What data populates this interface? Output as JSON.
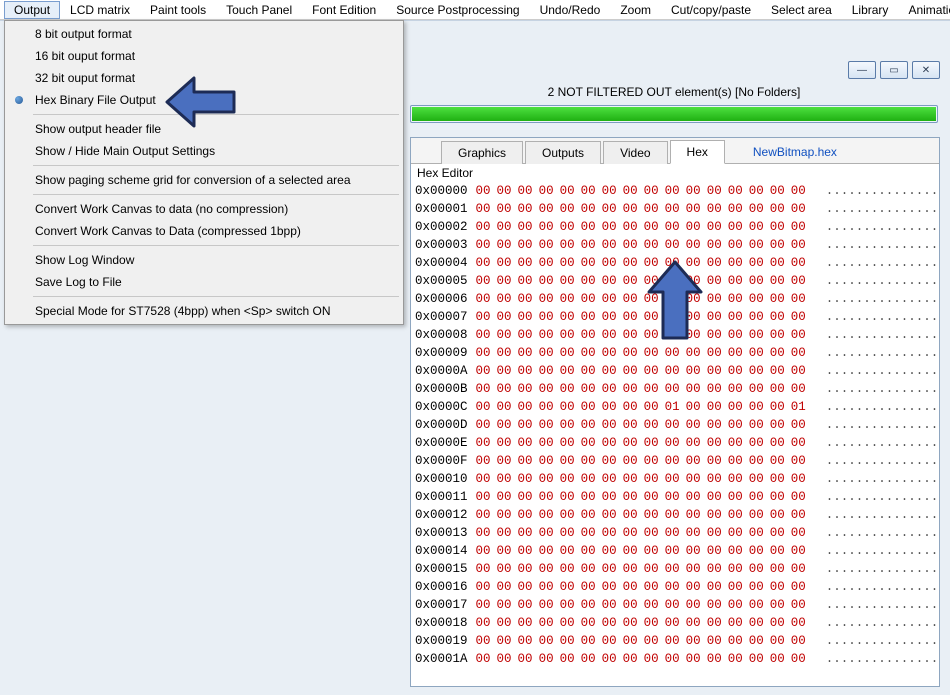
{
  "menubar": {
    "items": [
      "Output",
      "LCD matrix",
      "Paint tools",
      "Touch Panel",
      "Font Edition",
      "Source Postprocessing",
      "Undo/Redo",
      "Zoom",
      "Cut/copy/paste",
      "Select area",
      "Library",
      "Animation"
    ],
    "active_index": 0
  },
  "dropdown": {
    "groups": [
      [
        {
          "label": "8 bit output format",
          "checked": false
        },
        {
          "label": "16 bit ouput format",
          "checked": false
        },
        {
          "label": "32 bit ouput format",
          "checked": false
        },
        {
          "label": "Hex Binary File Output",
          "checked": true
        }
      ],
      [
        {
          "label": "Show output header file",
          "checked": false
        },
        {
          "label": "Show / Hide Main Output  Settings",
          "checked": false
        }
      ],
      [
        {
          "label": "Show paging scheme grid for conversion of a selected area",
          "checked": false
        }
      ],
      [
        {
          "label": "Convert Work Canvas to data (no compression)",
          "checked": false
        },
        {
          "label": "Convert Work Canvas to Data (compressed 1bpp)",
          "checked": false
        }
      ],
      [
        {
          "label": "Show Log Window",
          "checked": false
        },
        {
          "label": "Save Log to File",
          "checked": false
        }
      ],
      [
        {
          "label": "Special Mode for ST7528 (4bpp) when <Sp> switch ON",
          "checked": false
        }
      ]
    ]
  },
  "window": {
    "status_text": "2 NOT FILTERED OUT element(s) [No Folders]",
    "progress_pct": 100,
    "controls": {
      "min": "—",
      "max": "▭",
      "close": "✕"
    }
  },
  "tabs": {
    "items": [
      "Graphics",
      "Outputs",
      "Video",
      "Hex"
    ],
    "active_index": 3,
    "link": "NewBitmap.hex"
  },
  "hex": {
    "title": "Hex Editor",
    "ascii_placeholder": "................",
    "rows": [
      {
        "addr": "0x00000",
        "bytes": [
          "00",
          "00",
          "00",
          "00",
          "00",
          "00",
          "00",
          "00",
          "00",
          "00",
          "00",
          "00",
          "00",
          "00",
          "00",
          "00"
        ]
      },
      {
        "addr": "0x00001",
        "bytes": [
          "00",
          "00",
          "00",
          "00",
          "00",
          "00",
          "00",
          "00",
          "00",
          "00",
          "00",
          "00",
          "00",
          "00",
          "00",
          "00"
        ]
      },
      {
        "addr": "0x00002",
        "bytes": [
          "00",
          "00",
          "00",
          "00",
          "00",
          "00",
          "00",
          "00",
          "00",
          "00",
          "00",
          "00",
          "00",
          "00",
          "00",
          "00"
        ]
      },
      {
        "addr": "0x00003",
        "bytes": [
          "00",
          "00",
          "00",
          "00",
          "00",
          "00",
          "00",
          "00",
          "00",
          "00",
          "00",
          "00",
          "00",
          "00",
          "00",
          "00"
        ]
      },
      {
        "addr": "0x00004",
        "bytes": [
          "00",
          "00",
          "00",
          "00",
          "00",
          "00",
          "00",
          "00",
          "00",
          "00",
          "00",
          "00",
          "00",
          "00",
          "00",
          "00"
        ]
      },
      {
        "addr": "0x00005",
        "bytes": [
          "00",
          "00",
          "00",
          "00",
          "00",
          "00",
          "00",
          "00",
          "00",
          "00",
          "00",
          "00",
          "00",
          "00",
          "00",
          "00"
        ]
      },
      {
        "addr": "0x00006",
        "bytes": [
          "00",
          "00",
          "00",
          "00",
          "00",
          "00",
          "00",
          "00",
          "00",
          "00",
          "00",
          "00",
          "00",
          "00",
          "00",
          "00"
        ]
      },
      {
        "addr": "0x00007",
        "bytes": [
          "00",
          "00",
          "00",
          "00",
          "00",
          "00",
          "00",
          "00",
          "00",
          "00",
          "00",
          "00",
          "00",
          "00",
          "00",
          "00"
        ]
      },
      {
        "addr": "0x00008",
        "bytes": [
          "00",
          "00",
          "00",
          "00",
          "00",
          "00",
          "00",
          "00",
          "00",
          "00",
          "00",
          "00",
          "00",
          "00",
          "00",
          "00"
        ]
      },
      {
        "addr": "0x00009",
        "bytes": [
          "00",
          "00",
          "00",
          "00",
          "00",
          "00",
          "00",
          "00",
          "00",
          "00",
          "00",
          "00",
          "00",
          "00",
          "00",
          "00"
        ]
      },
      {
        "addr": "0x0000A",
        "bytes": [
          "00",
          "00",
          "00",
          "00",
          "00",
          "00",
          "00",
          "00",
          "00",
          "00",
          "00",
          "00",
          "00",
          "00",
          "00",
          "00"
        ]
      },
      {
        "addr": "0x0000B",
        "bytes": [
          "00",
          "00",
          "00",
          "00",
          "00",
          "00",
          "00",
          "00",
          "00",
          "00",
          "00",
          "00",
          "00",
          "00",
          "00",
          "00"
        ]
      },
      {
        "addr": "0x0000C",
        "bytes": [
          "00",
          "00",
          "00",
          "00",
          "00",
          "00",
          "00",
          "00",
          "00",
          "01",
          "00",
          "00",
          "00",
          "00",
          "00",
          "01"
        ]
      },
      {
        "addr": "0x0000D",
        "bytes": [
          "00",
          "00",
          "00",
          "00",
          "00",
          "00",
          "00",
          "00",
          "00",
          "00",
          "00",
          "00",
          "00",
          "00",
          "00",
          "00"
        ]
      },
      {
        "addr": "0x0000E",
        "bytes": [
          "00",
          "00",
          "00",
          "00",
          "00",
          "00",
          "00",
          "00",
          "00",
          "00",
          "00",
          "00",
          "00",
          "00",
          "00",
          "00"
        ]
      },
      {
        "addr": "0x0000F",
        "bytes": [
          "00",
          "00",
          "00",
          "00",
          "00",
          "00",
          "00",
          "00",
          "00",
          "00",
          "00",
          "00",
          "00",
          "00",
          "00",
          "00"
        ]
      },
      {
        "addr": "0x00010",
        "bytes": [
          "00",
          "00",
          "00",
          "00",
          "00",
          "00",
          "00",
          "00",
          "00",
          "00",
          "00",
          "00",
          "00",
          "00",
          "00",
          "00"
        ]
      },
      {
        "addr": "0x00011",
        "bytes": [
          "00",
          "00",
          "00",
          "00",
          "00",
          "00",
          "00",
          "00",
          "00",
          "00",
          "00",
          "00",
          "00",
          "00",
          "00",
          "00"
        ]
      },
      {
        "addr": "0x00012",
        "bytes": [
          "00",
          "00",
          "00",
          "00",
          "00",
          "00",
          "00",
          "00",
          "00",
          "00",
          "00",
          "00",
          "00",
          "00",
          "00",
          "00"
        ]
      },
      {
        "addr": "0x00013",
        "bytes": [
          "00",
          "00",
          "00",
          "00",
          "00",
          "00",
          "00",
          "00",
          "00",
          "00",
          "00",
          "00",
          "00",
          "00",
          "00",
          "00"
        ]
      },
      {
        "addr": "0x00014",
        "bytes": [
          "00",
          "00",
          "00",
          "00",
          "00",
          "00",
          "00",
          "00",
          "00",
          "00",
          "00",
          "00",
          "00",
          "00",
          "00",
          "00"
        ]
      },
      {
        "addr": "0x00015",
        "bytes": [
          "00",
          "00",
          "00",
          "00",
          "00",
          "00",
          "00",
          "00",
          "00",
          "00",
          "00",
          "00",
          "00",
          "00",
          "00",
          "00"
        ]
      },
      {
        "addr": "0x00016",
        "bytes": [
          "00",
          "00",
          "00",
          "00",
          "00",
          "00",
          "00",
          "00",
          "00",
          "00",
          "00",
          "00",
          "00",
          "00",
          "00",
          "00"
        ]
      },
      {
        "addr": "0x00017",
        "bytes": [
          "00",
          "00",
          "00",
          "00",
          "00",
          "00",
          "00",
          "00",
          "00",
          "00",
          "00",
          "00",
          "00",
          "00",
          "00",
          "00"
        ]
      },
      {
        "addr": "0x00018",
        "bytes": [
          "00",
          "00",
          "00",
          "00",
          "00",
          "00",
          "00",
          "00",
          "00",
          "00",
          "00",
          "00",
          "00",
          "00",
          "00",
          "00"
        ]
      },
      {
        "addr": "0x00019",
        "bytes": [
          "00",
          "00",
          "00",
          "00",
          "00",
          "00",
          "00",
          "00",
          "00",
          "00",
          "00",
          "00",
          "00",
          "00",
          "00",
          "00"
        ]
      },
      {
        "addr": "0x0001A",
        "bytes": [
          "00",
          "00",
          "00",
          "00",
          "00",
          "00",
          "00",
          "00",
          "00",
          "00",
          "00",
          "00",
          "00",
          "00",
          "00",
          "00"
        ]
      }
    ]
  },
  "arrows": {
    "color": "#4a6fbf",
    "stroke": "#1d2b55"
  }
}
